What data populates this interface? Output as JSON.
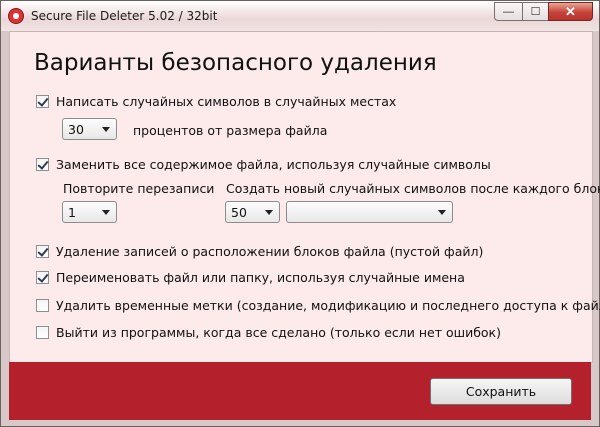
{
  "window": {
    "title": "Secure File Deleter 5.02 / 32bit",
    "controls": {
      "minimize": "—",
      "maximize": "☐",
      "close": "✕"
    }
  },
  "heading": "Варианты безопасного удаления",
  "options": {
    "random_chars": {
      "label": "Написать случайных символов в случайных местах",
      "checked": true
    },
    "percent": {
      "value": "30",
      "suffix": "процентов от размера файла"
    },
    "replace_content": {
      "label": "Заменить все содержимое файла, используя случайные символы",
      "checked": true
    },
    "repeat_label": "Повторите перезаписи",
    "repeat_value": "1",
    "new_chars_label": "Создать новый случайных символов после каждого блока",
    "new_chars_value": "50",
    "new_chars_unit": "",
    "delete_blocks": {
      "label": "Удаление записей о расположении блоков файла (пустой файл)",
      "checked": true
    },
    "rename": {
      "label": "Переименовать файл или папку, используя случайные имена",
      "checked": true
    },
    "timestamps": {
      "label": "Удалить временные метки (создание, модификацию и последнего доступа к файлу)",
      "checked": false
    },
    "exit": {
      "label": "Выйти из программы, когда все сделано (только если нет ошибок)",
      "checked": false
    }
  },
  "footer": {
    "save_label": "Сохранить"
  },
  "colors": {
    "accent": "#b4202c",
    "content_bg": "#fdeaea"
  }
}
